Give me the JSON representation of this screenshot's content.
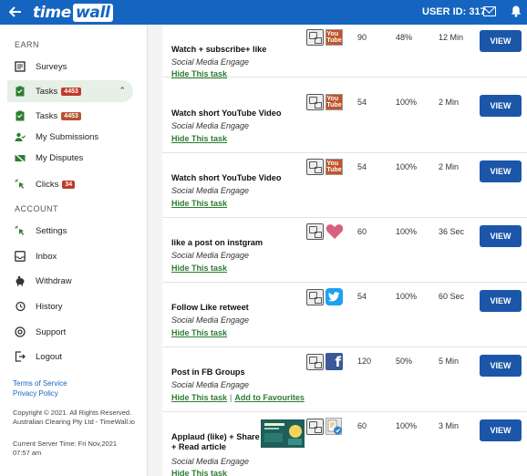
{
  "header": {
    "logo_time": "time",
    "logo_wall": "wall",
    "user_id": "USER ID: 317"
  },
  "sidebar": {
    "earn_label": "EARN",
    "account_label": "ACCOUNT",
    "items": [
      {
        "label": "Surveys",
        "icon": "survey-icon"
      },
      {
        "label": "Tasks",
        "badge": "4453",
        "icon": "clipboard-icon"
      },
      {
        "label": "Tasks",
        "badge": "4453",
        "icon": "clipboard-icon"
      },
      {
        "label": "My Submissions",
        "icon": "submissions-icon"
      },
      {
        "label": "My Disputes",
        "icon": "disputes-icon"
      },
      {
        "label": "Clicks",
        "badge": "34",
        "icon": "cursor-icon"
      },
      {
        "label": "Settings",
        "icon": "gear-icon"
      },
      {
        "label": "Inbox",
        "icon": "inbox-icon"
      },
      {
        "label": "Withdraw",
        "icon": "piggy-bank-icon"
      },
      {
        "label": "History",
        "icon": "history-icon"
      },
      {
        "label": "Support",
        "icon": "support-icon"
      },
      {
        "label": "Logout",
        "icon": "logout-icon"
      }
    ],
    "terms": "Terms of Service",
    "privacy": "Privacy Policy",
    "copyright": "Copyright © 2021. All Rights Reserved. Australian Clearing Pty Ltd - TimeWall.io",
    "server_time": "Current Server Time: Fri Nov,2021 07:57 am"
  },
  "tasks": [
    {
      "title": "Watch + subscribe+ like",
      "category": "Social Media Engage",
      "hide": "Hide This task",
      "reward": "90",
      "rate": "48%",
      "time": "12 Min",
      "button": "VIEW",
      "platform": "youtube-icon"
    },
    {
      "title": "Watch short YouTube Video",
      "category": "Social Media Engage",
      "hide": "Hide This task",
      "reward": "54",
      "rate": "100%",
      "time": "2 Min",
      "button": "VIEW",
      "platform": "youtube-icon"
    },
    {
      "title": "Watch short YouTube Video",
      "category": "Social Media Engage",
      "hide": "Hide This task",
      "reward": "54",
      "rate": "100%",
      "time": "2 Min",
      "button": "VIEW",
      "platform": "youtube-icon"
    },
    {
      "title": "like a post on instgram",
      "category": "Social Media Engage",
      "hide": "Hide This task",
      "reward": "60",
      "rate": "100%",
      "time": "36 Sec",
      "button": "VIEW",
      "platform": "heart-icon"
    },
    {
      "title": "Follow Like retweet",
      "category": "Social Media Engage",
      "hide": "Hide This task",
      "reward": "54",
      "rate": "100%",
      "time": "60 Sec",
      "button": "VIEW",
      "platform": "twitter-icon"
    },
    {
      "title": "Post in FB Groups",
      "category": "Social Media Engage",
      "hide": "Hide This task",
      "fav": "Add to Favourites",
      "reward": "120",
      "rate": "50%",
      "time": "5 Min",
      "button": "VIEW",
      "platform": "facebook-icon"
    },
    {
      "title": "Applaud (like) + Share + Read article",
      "category": "Social Media Engage",
      "hide": "Hide This task",
      "reward": "60",
      "rate": "100%",
      "time": "3 Min",
      "button": "VIEW",
      "platform": "applaud-icon"
    }
  ]
}
